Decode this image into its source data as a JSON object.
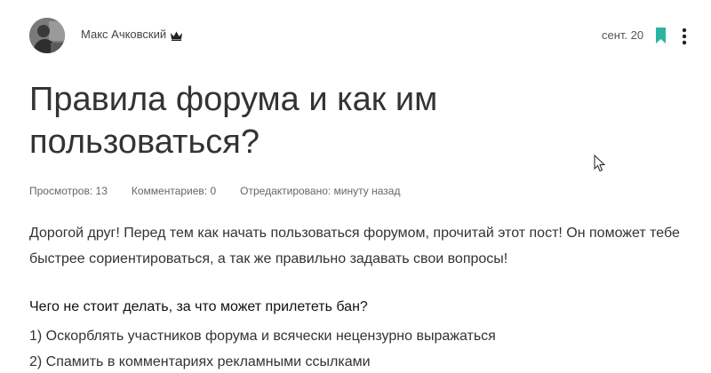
{
  "header": {
    "author_name": "Макс Ачковский",
    "author_badge_icon": "crown-icon",
    "date": "сент. 20",
    "bookmark_icon": "bookmark-icon",
    "more_icon": "more-vertical-icon",
    "accent_color": "#2bb5a0"
  },
  "post": {
    "title": "Правила форума и как им пользоваться?",
    "stats": {
      "views": "Просмотров: 13",
      "comments": "Комментариев: 0",
      "edited": "Отредактировано: минуту назад"
    },
    "intro": "Дорогой друг! Перед тем как начать пользоваться форумом, прочитай этот пост! Он поможет тебе быстрее сориентироваться, а так же правильно задавать свои вопросы!",
    "rules_heading": "Чего не стоит делать, за что может прилететь бан?",
    "rules": [
      "1) Оскорблять участников форума и всячески нецензурно выражаться",
      "2) Спамить в комментариях рекламными ссылками"
    ]
  }
}
